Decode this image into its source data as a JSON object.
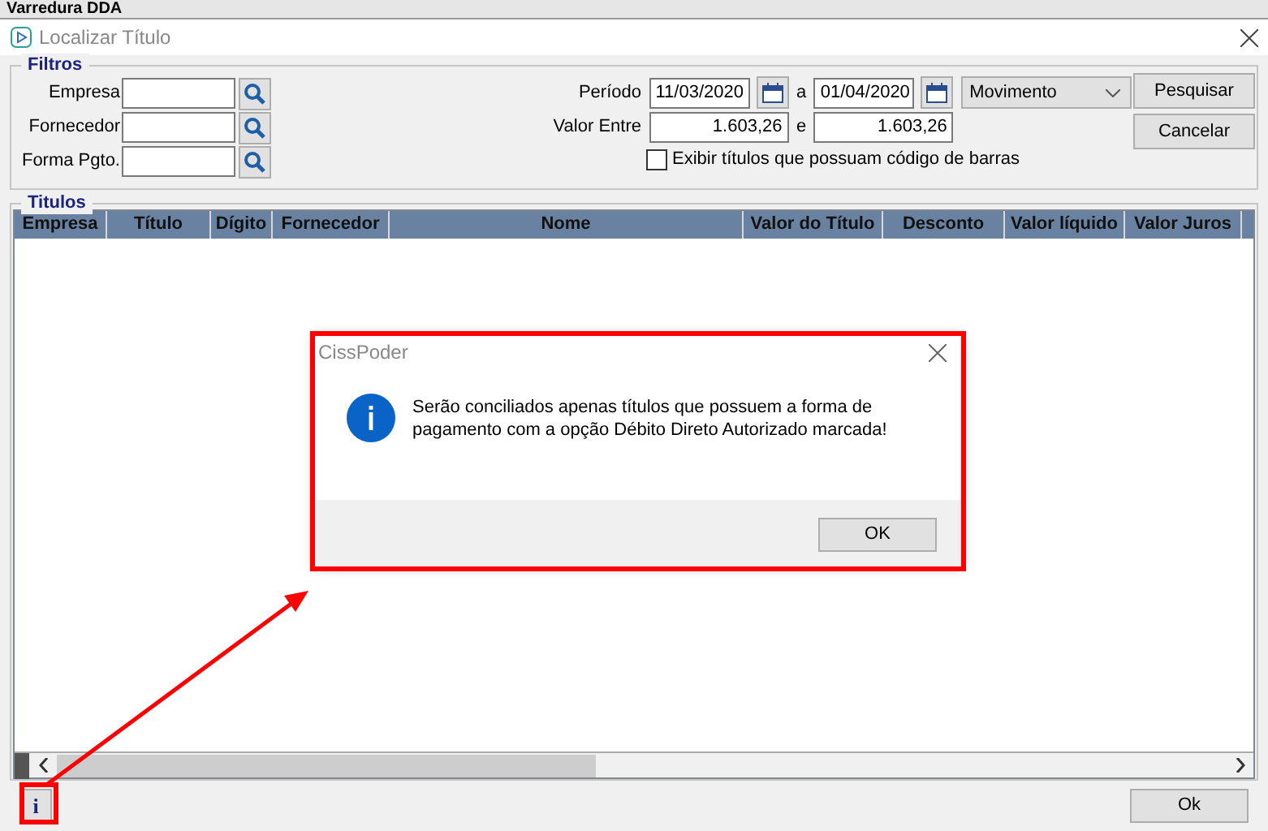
{
  "background_window": {
    "title": "Varredura DDA"
  },
  "window": {
    "title": "Localizar Título"
  },
  "filters": {
    "legend": "Filtros",
    "lookups": [
      {
        "label": "Empresa"
      },
      {
        "label": "Fornecedor"
      },
      {
        "label": "Forma Pgto."
      }
    ],
    "period": {
      "label": "Período",
      "from": "11/03/2020",
      "separator": "a",
      "to": "01/04/2020",
      "mode": "Movimento"
    },
    "value_range": {
      "label": "Valor Entre",
      "from": "1.603,26",
      "separator": "e",
      "to": "1.603,26"
    },
    "barcode_checkbox": {
      "label": "Exibir títulos que possuam código de barras",
      "checked": false
    },
    "buttons": [
      "Pesquisar",
      "Cancelar"
    ]
  },
  "titles": {
    "legend": "Titulos",
    "columns": [
      "Empresa",
      "Título",
      "Dígito",
      "Fornecedor",
      "Nome",
      "Valor do Título",
      "Desconto",
      "Valor líquido",
      "Valor Juros"
    ]
  },
  "footer": {
    "info_button": "i",
    "ok_button": "Ok"
  },
  "dialog": {
    "title": "CissPoder",
    "message": "Serão conciliados apenas títulos que possuem a forma de pagamento com a opção Débito Direto Autorizado marcada!",
    "button": "OK"
  }
}
